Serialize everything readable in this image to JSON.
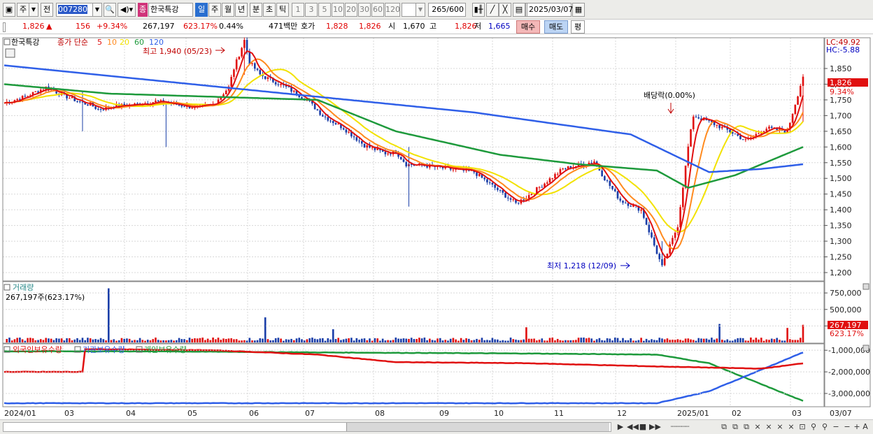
{
  "toolbar": {
    "period_label": "주",
    "prev_label": "전",
    "stock_code": "007280",
    "stock_name": "한국특강",
    "badge": "종",
    "periods": [
      "일",
      "주",
      "월",
      "년",
      "분",
      "초",
      "틱"
    ],
    "intervals": [
      "1",
      "3",
      "5",
      "10",
      "20",
      "30",
      "60",
      "120"
    ],
    "count_label": "265",
    "count_total": "/600",
    "date": "2025/03/07"
  },
  "quote": {
    "price": "1,826",
    "change_arrow": "▲",
    "change": "156",
    "change_pct": "+9.34%",
    "volume": "267,197",
    "volume_ratio": "623.17%",
    "turnover": "0.44%",
    "amount": "471백만",
    "ask_label": "호가",
    "ask": "1,828",
    "bid": "1,826",
    "open_label": "시",
    "open": "1,670",
    "high_label": "고",
    "high": "1,826",
    "low_label": "저",
    "low": "1,665",
    "buy_label": "매수",
    "sell_label": "매도",
    "eval_label": "평"
  },
  "price_panel": {
    "stock_name": "한국특강",
    "ma_label": "종가 단순",
    "ma_periods": [
      "5",
      "10",
      "20",
      "60",
      "120"
    ],
    "ma_colors": [
      "#e01010",
      "#ff8a1e",
      "#f2e200",
      "#1e9a3c",
      "#2f5fe8"
    ],
    "high_annotation": "최고 1,940 (05/23)",
    "low_annotation": "최저 1,218 (12/09)",
    "dividend_annotation": "배당락(0.00%)",
    "lc": "LC:49.92",
    "hc": "HC:-5.88",
    "price_marker": "1,826",
    "pct_marker": "9.34%"
  },
  "volume_panel": {
    "title": "거래량",
    "value": "267,197주(623.17%)",
    "marker_value": "267,197",
    "marker_pct": "623.17%"
  },
  "holding_panel": {
    "legend": [
      "외국인보유수량",
      "기관보유수량",
      "개인보유수량"
    ],
    "legend_colors": [
      "#e01010",
      "#2f5fe8",
      "#1e9a3c"
    ]
  },
  "chart_data": {
    "type": "line",
    "title": "",
    "price_axis_ticks": [
      "1,850",
      "1,800",
      "1,750",
      "1,700",
      "1,650",
      "1,600",
      "1,550",
      "1,500",
      "1,450",
      "1,400",
      "1,350",
      "1,300",
      "1,250",
      "1,200"
    ],
    "volume_axis_ticks": [
      "750,000",
      "500,000",
      "250,000"
    ],
    "holding_axis_ticks": [
      "-1,000,000",
      "-2,000,000",
      "-3,000,000"
    ],
    "x_tick_labels": [
      "2024/01",
      "03",
      "04",
      "05",
      "06",
      "07",
      "08",
      "09",
      "10",
      "11",
      "12",
      "2025/01",
      "02",
      "03",
      "03/07"
    ],
    "close_keypoints": {
      "week": [
        0,
        8,
        16,
        24,
        30,
        33,
        36,
        42,
        50,
        58,
        66,
        74,
        80,
        86,
        88,
        92,
        94,
        98,
        108,
        116,
        122,
        130,
        138,
        146,
        150,
        154,
        162,
        170,
        180,
        196,
        200,
        214,
        222,
        226,
        230,
        236,
        244,
        252,
        258,
        262,
        264
      ],
      "value": [
        1740,
        1760,
        1790,
        1760,
        1740,
        1735,
        1720,
        1730,
        1735,
        1745,
        1735,
        1725,
        1735,
        1790,
        1850,
        1940,
        1870,
        1830,
        1790,
        1750,
        1700,
        1660,
        1605,
        1580,
        1585,
        1545,
        1540,
        1530,
        1520,
        1420,
        1440,
        1530,
        1545,
        1555,
        1500,
        1430,
        1400,
        1218,
        1350,
        1600,
        1700
      ]
    },
    "extra_close_points": {
      "week": [
        264,
        270,
        278,
        284,
        292,
        300,
        306
      ],
      "value": [
        1700,
        1680,
        1650,
        1620,
        1660,
        1650,
        1826
      ]
    },
    "ma60_keypoints": {
      "week": [
        0,
        40,
        80,
        120,
        150,
        190,
        220,
        250,
        262,
        280,
        306
      ],
      "value": [
        1800,
        1770,
        1760,
        1750,
        1650,
        1575,
        1545,
        1525,
        1470,
        1510,
        1600
      ]
    },
    "ma120_keypoints": {
      "week": [
        0,
        60,
        120,
        180,
        240,
        270,
        290,
        306
      ],
      "value": [
        1860,
        1810,
        1760,
        1710,
        1640,
        1520,
        1530,
        1545
      ]
    },
    "foreign_keypoints": {
      "week": [
        0,
        30,
        31,
        80,
        120,
        150,
        200,
        250,
        290,
        300,
        306
      ],
      "value": [
        -2,
        -2,
        -0.95,
        -1.0,
        -1.2,
        -1.55,
        -1.6,
        -1.75,
        -1.85,
        -1.7,
        -1.6
      ]
    },
    "institution_keypoints": {
      "week": [
        0,
        60,
        120,
        200,
        250,
        270,
        306
      ],
      "value": [
        -3.45,
        -3.45,
        -3.45,
        -3.45,
        -3.45,
        -2.9,
        -1.1
      ]
    },
    "individual_keypoints": {
      "week": [
        0,
        60,
        120,
        200,
        250,
        270,
        306
      ],
      "value": [
        -1.05,
        -1.05,
        -1.1,
        -1.15,
        -1.2,
        -1.6,
        -3.35
      ]
    },
    "volume_spikes": {
      "week": [
        40,
        100,
        126,
        200,
        274,
        300,
        306
      ],
      "value": [
        820000,
        380000,
        200000,
        230000,
        280000,
        220000,
        267197
      ]
    }
  }
}
